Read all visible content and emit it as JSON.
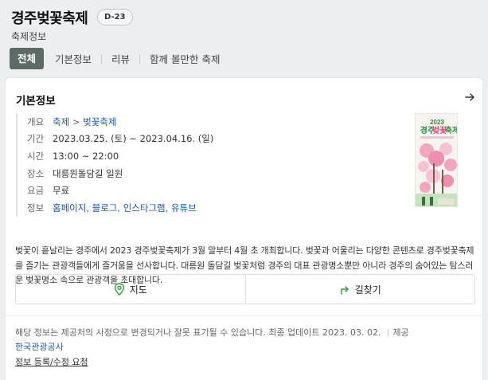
{
  "header": {
    "title": "경주벚꽃축제",
    "dday": "D-23",
    "subtitle": "축제정보",
    "tabs": [
      {
        "label": "전체",
        "active": true
      },
      {
        "label": "기본정보"
      },
      {
        "label": "리뷰"
      },
      {
        "label": "함께 볼만한 축제"
      }
    ]
  },
  "info": {
    "section_title": "기본정보",
    "rows": {
      "overview": {
        "label": "개요",
        "cat1": "축제",
        "arrow": ">",
        "cat2": "벚꽃축제"
      },
      "period": {
        "label": "기간",
        "value": "2023.03.25. (토) ~  2023.04.16. (일)"
      },
      "time": {
        "label": "시간",
        "value": "13:00 ~ 22:00"
      },
      "place": {
        "label": "장소",
        "value": "대릉원돌담길 일원"
      },
      "fee": {
        "label": "요금",
        "value": "무료"
      },
      "links": {
        "label": "정보",
        "items": [
          "홈페이지",
          "블로그",
          "인스타그램",
          "유튜브"
        ],
        "comma": ","
      }
    },
    "poster": {
      "year": "2023",
      "title_a": "경주",
      "title_b": "벚꽃",
      "title_c": "축제"
    }
  },
  "description": "벚꽃이 흩날리는 경주에서 2023 경주벚꽃축제가 3월 말부터 4월 초 개최합니다. 벚꽃과 어울리는 다양한 콘텐츠로 경주벚꽃축제를 즐기는 관광객들에게 즐거움을 선사합니다. 대릉원 돌담길 벚꽃처럼 경주의 대표 관광명소뿐만 아니라 경주의 숨어있는 탐스러운 벚꽃명소 속으로 관광객을 초대합니다.",
  "actions": {
    "map": "지도",
    "directions": "길찾기"
  },
  "footer": {
    "notice": "해당 정보는 제공처의 사정으로 변경되거나 잘못 표기될 수 있습니다. 최종 업데이트 2023. 03. 02.",
    "provider_label": "제공",
    "source": "한국관광공사",
    "edit_link": "정보 등록/수정 요청"
  },
  "colors": {
    "accent": "#5c6b66",
    "link": "#1a57b5",
    "icon_green": "#2e9e3f"
  }
}
